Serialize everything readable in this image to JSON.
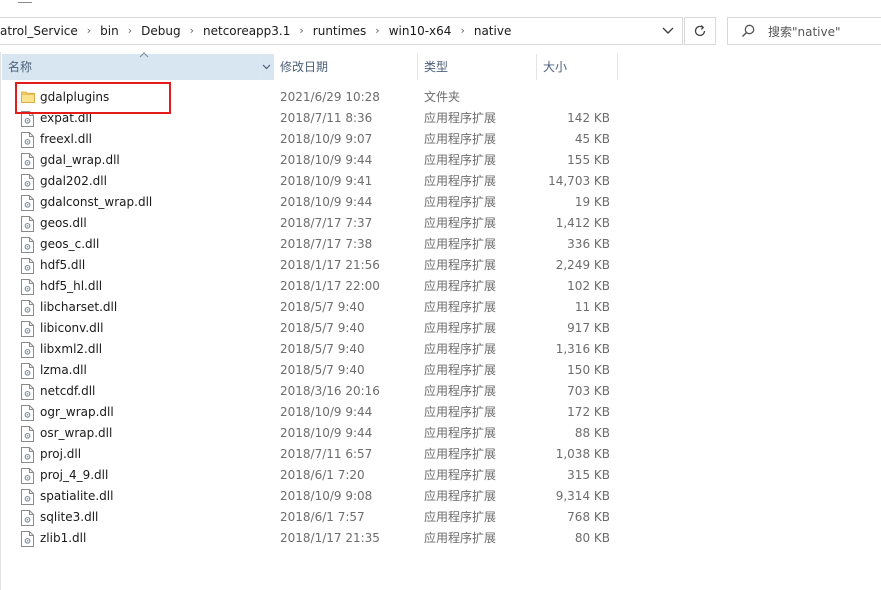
{
  "address": {
    "crumbs": [
      "atrol_Service",
      "bin",
      "Debug",
      "netcoreapp3.1",
      "runtimes",
      "win10-x64",
      "native"
    ],
    "separator": "›"
  },
  "search": {
    "placeholder": "搜索\"native\""
  },
  "columns": {
    "name": "名称",
    "date": "修改日期",
    "type": "类型",
    "size": "大小"
  },
  "files": [
    {
      "name": "gdalplugins",
      "date": "2021/6/29 10:28",
      "type": "文件夹",
      "size": "",
      "icon": "folder-icon"
    },
    {
      "name": "expat.dll",
      "date": "2018/7/11 8:36",
      "type": "应用程序扩展",
      "size": "142 KB",
      "icon": "dll-file-icon"
    },
    {
      "name": "freexl.dll",
      "date": "2018/10/9 9:07",
      "type": "应用程序扩展",
      "size": "45 KB",
      "icon": "dll-file-icon"
    },
    {
      "name": "gdal_wrap.dll",
      "date": "2018/10/9 9:44",
      "type": "应用程序扩展",
      "size": "155 KB",
      "icon": "dll-file-icon"
    },
    {
      "name": "gdal202.dll",
      "date": "2018/10/9 9:41",
      "type": "应用程序扩展",
      "size": "14,703 KB",
      "icon": "dll-file-icon"
    },
    {
      "name": "gdalconst_wrap.dll",
      "date": "2018/10/9 9:44",
      "type": "应用程序扩展",
      "size": "19 KB",
      "icon": "dll-file-icon"
    },
    {
      "name": "geos.dll",
      "date": "2018/7/17 7:37",
      "type": "应用程序扩展",
      "size": "1,412 KB",
      "icon": "dll-file-icon"
    },
    {
      "name": "geos_c.dll",
      "date": "2018/7/17 7:38",
      "type": "应用程序扩展",
      "size": "336 KB",
      "icon": "dll-file-icon"
    },
    {
      "name": "hdf5.dll",
      "date": "2018/1/17 21:56",
      "type": "应用程序扩展",
      "size": "2,249 KB",
      "icon": "dll-file-icon"
    },
    {
      "name": "hdf5_hl.dll",
      "date": "2018/1/17 22:00",
      "type": "应用程序扩展",
      "size": "102 KB",
      "icon": "dll-file-icon"
    },
    {
      "name": "libcharset.dll",
      "date": "2018/5/7 9:40",
      "type": "应用程序扩展",
      "size": "11 KB",
      "icon": "dll-file-icon"
    },
    {
      "name": "libiconv.dll",
      "date": "2018/5/7 9:40",
      "type": "应用程序扩展",
      "size": "917 KB",
      "icon": "dll-file-icon"
    },
    {
      "name": "libxml2.dll",
      "date": "2018/5/7 9:40",
      "type": "应用程序扩展",
      "size": "1,316 KB",
      "icon": "dll-file-icon"
    },
    {
      "name": "lzma.dll",
      "date": "2018/5/7 9:40",
      "type": "应用程序扩展",
      "size": "150 KB",
      "icon": "dll-file-icon"
    },
    {
      "name": "netcdf.dll",
      "date": "2018/3/16 20:16",
      "type": "应用程序扩展",
      "size": "703 KB",
      "icon": "dll-file-icon"
    },
    {
      "name": "ogr_wrap.dll",
      "date": "2018/10/9 9:44",
      "type": "应用程序扩展",
      "size": "172 KB",
      "icon": "dll-file-icon"
    },
    {
      "name": "osr_wrap.dll",
      "date": "2018/10/9 9:44",
      "type": "应用程序扩展",
      "size": "88 KB",
      "icon": "dll-file-icon"
    },
    {
      "name": "proj.dll",
      "date": "2018/7/11 6:57",
      "type": "应用程序扩展",
      "size": "1,038 KB",
      "icon": "dll-file-icon"
    },
    {
      "name": "proj_4_9.dll",
      "date": "2018/6/1 7:20",
      "type": "应用程序扩展",
      "size": "315 KB",
      "icon": "dll-file-icon"
    },
    {
      "name": "spatialite.dll",
      "date": "2018/10/9 9:08",
      "type": "应用程序扩展",
      "size": "9,314 KB",
      "icon": "dll-file-icon"
    },
    {
      "name": "sqlite3.dll",
      "date": "2018/6/1 7:57",
      "type": "应用程序扩展",
      "size": "768 KB",
      "icon": "dll-file-icon"
    },
    {
      "name": "zlib1.dll",
      "date": "2018/1/17 21:35",
      "type": "应用程序扩展",
      "size": "80 KB",
      "icon": "dll-file-icon"
    }
  ],
  "colors": {
    "header_selected": "#d8e6f2",
    "header_text": "#4c607a",
    "highlight": "#e21b1b",
    "folder": "#f7d26b"
  }
}
